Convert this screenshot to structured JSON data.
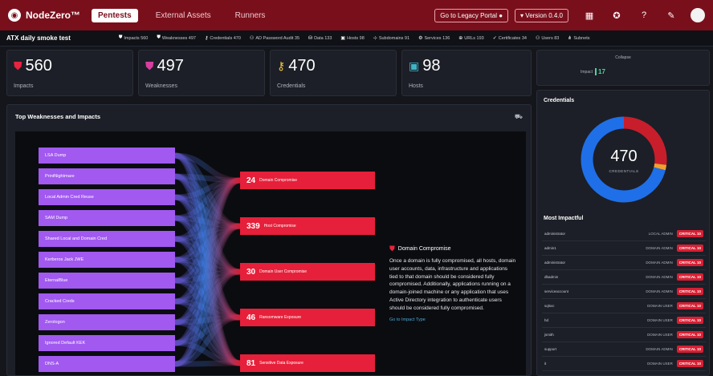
{
  "nav": {
    "brand": "NodeZero™",
    "tabs": [
      {
        "label": "Pentests",
        "active": true
      },
      {
        "label": "External Assets",
        "active": false
      },
      {
        "label": "Runners",
        "active": false
      }
    ],
    "legacy_button": "Go to Legacy Portal",
    "version_button": "Version 0.4.0"
  },
  "subbar": {
    "title": "ATX daily smoke test",
    "chips": [
      {
        "icon": "shield",
        "label": "Impacts",
        "value": "560"
      },
      {
        "icon": "shield",
        "label": "Weaknesses",
        "value": "497"
      },
      {
        "icon": "key",
        "label": "Credentials",
        "value": "470"
      },
      {
        "icon": "users",
        "label": "AD Password Audit",
        "value": "35"
      },
      {
        "icon": "db",
        "label": "Data",
        "value": "133"
      },
      {
        "icon": "host",
        "label": "Hosts",
        "value": "98"
      },
      {
        "icon": "net",
        "label": "Subdomains",
        "value": "91"
      },
      {
        "icon": "svc",
        "label": "Services",
        "value": "136"
      },
      {
        "icon": "url",
        "label": "URLs",
        "value": "193"
      },
      {
        "icon": "cert",
        "label": "Certificates",
        "value": "34"
      },
      {
        "icon": "users",
        "label": "Users",
        "value": "83"
      },
      {
        "icon": "sub",
        "label": "Subnets",
        "value": ""
      }
    ]
  },
  "stats": [
    {
      "value": "560",
      "label": "Impacts"
    },
    {
      "value": "497",
      "label": "Weaknesses"
    },
    {
      "value": "470",
      "label": "Credentials"
    },
    {
      "value": "98",
      "label": "Hosts"
    }
  ],
  "right_top": {
    "title": "Collapse",
    "label": "Impact",
    "value": "17"
  },
  "credentials_panel": {
    "title": "Credentials",
    "total": "470",
    "caption": "CREDENTIALS",
    "donut": [
      {
        "name": "segment-1",
        "value": 0.27,
        "color": "#c81e2c"
      },
      {
        "name": "segment-2",
        "value": 0.02,
        "color": "#f0a030"
      },
      {
        "name": "segment-3",
        "value": 0.71,
        "color": "#1f6fe8"
      }
    ],
    "most_impactful_title": "Most Impactful",
    "rows": [
      {
        "name": "administrator",
        "role": "LOCAL ADMIN",
        "badge": "CRITICAL 10"
      },
      {
        "name": "admin1",
        "role": "DOMAIN ADMIN",
        "badge": "CRITICAL 10"
      },
      {
        "name": "administrator",
        "role": "DOMAIN ADMIN",
        "badge": "CRITICAL 10"
      },
      {
        "name": "dbadmin",
        "role": "DOMAIN ADMIN",
        "badge": "CRITICAL 10"
      },
      {
        "name": "serviceaccount",
        "role": "DOMAIN ADMIN",
        "badge": "CRITICAL 10"
      },
      {
        "name": "sqlsvc",
        "role": "DOMAIN USER",
        "badge": "CRITICAL 10"
      },
      {
        "name": "hd",
        "role": "DOMAIN USER",
        "badge": "CRITICAL 10"
      },
      {
        "name": "jsmith",
        "role": "DOMAIN USER",
        "badge": "CRITICAL 10"
      },
      {
        "name": "support",
        "role": "DOMAIN ADMIN",
        "badge": "CRITICAL 10"
      },
      {
        "name": "it",
        "role": "DOMAIN USER",
        "badge": "CRITICAL 10"
      }
    ]
  },
  "sankey": {
    "title": "Top Weaknesses and Impacts",
    "sources": [
      "LSA Dump",
      "PrintNightmare",
      "Local Admin Cred Reuse",
      "SAM Dump",
      "Shared Local and Domain Cred",
      "Kerberos Jack JWE",
      "EternalBlue",
      "Cracked Creds",
      "Zerologon",
      "Ignored Default KEK",
      "DNS-A"
    ],
    "targets": [
      {
        "value": "24",
        "label": "Domain Compromise"
      },
      {
        "value": "339",
        "label": "Host Compromise"
      },
      {
        "value": "30",
        "label": "Domain User Compromise"
      },
      {
        "value": "46",
        "label": "Ransomware Exposure"
      },
      {
        "value": "81",
        "label": "Sensitive Data Exposure"
      }
    ],
    "description": {
      "title": "Domain Compromise",
      "body": "Once a domain is fully compromised, all hosts, domain user accounts, data, infrastructure and applications tied to that domain should be considered fully compromised. Additionally, applications running on a domain-joined machine or any application that uses Active Directory integration to authenticate users should be considered fully compromised.",
      "link": "Go to Impact Type"
    }
  }
}
